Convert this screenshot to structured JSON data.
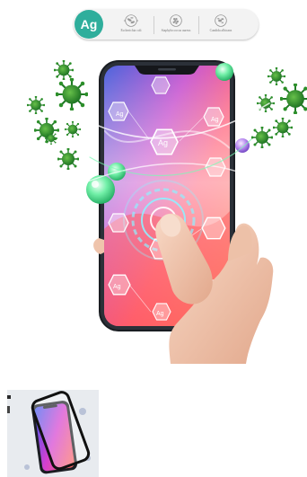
{
  "banner": {
    "badge_text": "Ag",
    "bacteria": [
      {
        "label": "Escherichia coli",
        "icon": "ecoli-bacteria-icon"
      },
      {
        "label": "Staphylococcus aureus",
        "icon": "staph-bacteria-icon"
      },
      {
        "label": "Candida albicans",
        "icon": "candida-fungus-icon"
      }
    ],
    "badge_color": "#2fae9c"
  },
  "hero": {
    "hex_label": "Ag",
    "virus_color": "#1f8a2a",
    "glow_color": "#7dfab5"
  },
  "thumbnail": {
    "icon": "screen-protector-thumbnail"
  }
}
